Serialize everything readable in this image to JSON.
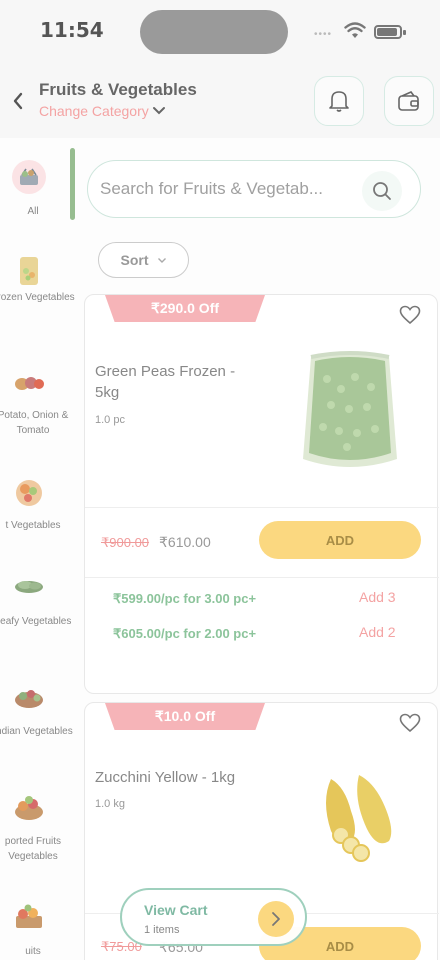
{
  "status": {
    "time": "11:54",
    "signal": "••••"
  },
  "header": {
    "title": "Fruits & Vegetables",
    "change_category": "Change Category"
  },
  "search": {
    "placeholder": "Search for Fruits & Vegetab..."
  },
  "sort": {
    "label": "Sort"
  },
  "categories": [
    {
      "label": "All",
      "icon": "basket-icon"
    },
    {
      "label": "Frozen Vegetables",
      "icon": "frozen-veg-icon"
    },
    {
      "label": "Potato, Onion & Tomato",
      "icon": "potato-onion-icon"
    },
    {
      "label": "t Vegetables",
      "icon": "cut-veg-icon"
    },
    {
      "label": "Leafy Vegetables",
      "icon": "leafy-icon"
    },
    {
      "label": "Indian Vegetables",
      "icon": "indian-veg-icon"
    },
    {
      "label": "ported Fruits Vegetables",
      "icon": "imported-fruits-icon"
    },
    {
      "label": "uits",
      "icon": "fruits-icon"
    }
  ],
  "products": [
    {
      "discount": "₹290.0 Off",
      "name": "Green Peas Frozen - 5kg",
      "unit": "1.0 pc",
      "price_old": "₹900.00",
      "price_new": "₹610.00",
      "add_label": "ADD",
      "tiers": [
        {
          "text": "₹599.00/pc for 3.00 pc+",
          "action": "Add 3"
        },
        {
          "text": "₹605.00/pc for 2.00 pc+",
          "action": "Add 2"
        }
      ]
    },
    {
      "discount": "₹10.0 Off",
      "name": "Zucchini Yellow - 1kg",
      "unit": "1.0 kg",
      "price_old": "₹75.00",
      "price_new": "₹65.00",
      "add_label": "ADD"
    }
  ],
  "cart": {
    "title": "View Cart",
    "count": "1 items"
  },
  "colors": {
    "accent_green": "#97bd90",
    "add_yellow": "#fbd880",
    "discount_pink": "#f6b4b8",
    "sub_red": "#f4a3a3"
  }
}
